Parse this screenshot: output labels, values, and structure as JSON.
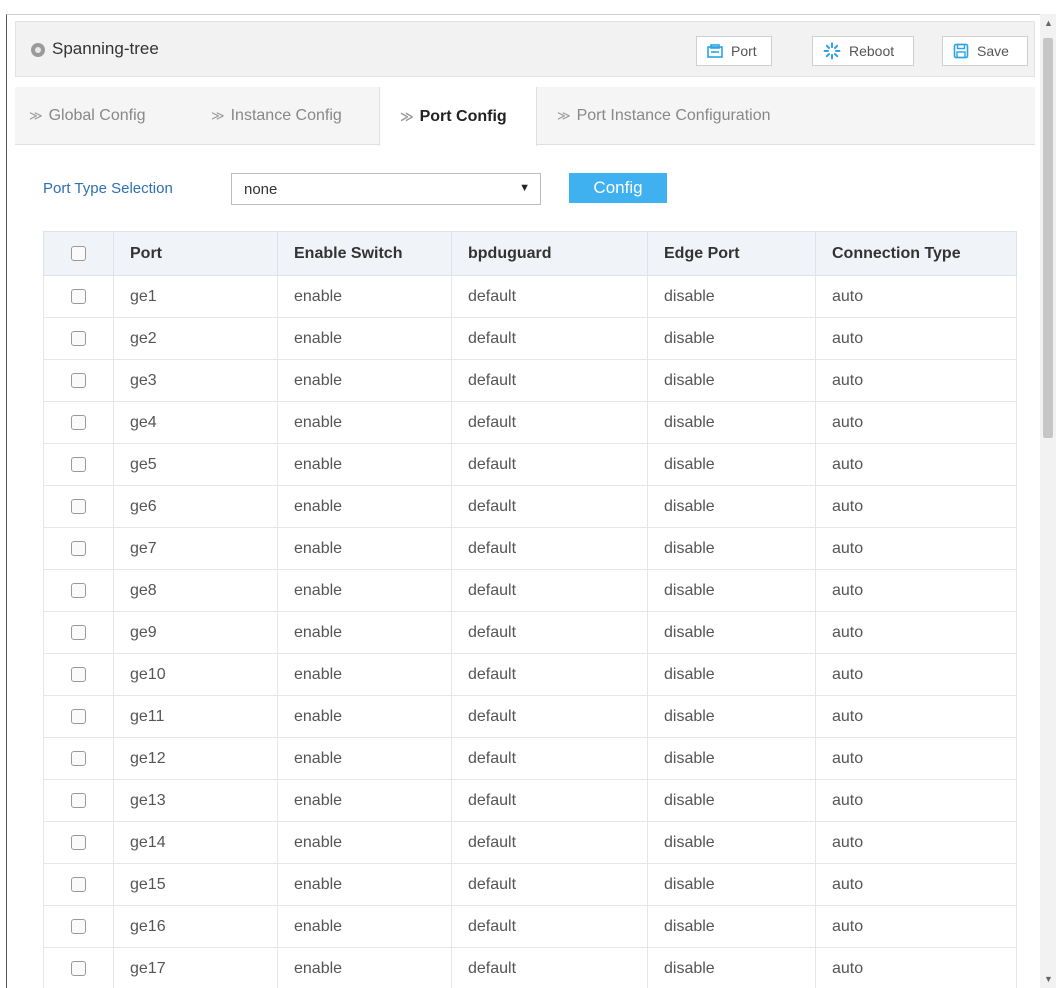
{
  "header": {
    "title": "Spanning-tree",
    "buttons": {
      "port": "Port",
      "reboot": "Reboot",
      "save": "Save"
    }
  },
  "tabs": [
    {
      "label": "Global Config",
      "active": false
    },
    {
      "label": "Instance Config",
      "active": false
    },
    {
      "label": "Port Config",
      "active": true
    },
    {
      "label": "Port Instance Configuration",
      "active": false
    }
  ],
  "filter": {
    "label": "Port Type Selection",
    "selected": "none",
    "config_label": "Config"
  },
  "table": {
    "columns": [
      "Port",
      "Enable Switch",
      "bpduguard",
      "Edge Port",
      "Connection Type"
    ],
    "rows": [
      [
        "ge1",
        "enable",
        "default",
        "disable",
        "auto"
      ],
      [
        "ge2",
        "enable",
        "default",
        "disable",
        "auto"
      ],
      [
        "ge3",
        "enable",
        "default",
        "disable",
        "auto"
      ],
      [
        "ge4",
        "enable",
        "default",
        "disable",
        "auto"
      ],
      [
        "ge5",
        "enable",
        "default",
        "disable",
        "auto"
      ],
      [
        "ge6",
        "enable",
        "default",
        "disable",
        "auto"
      ],
      [
        "ge7",
        "enable",
        "default",
        "disable",
        "auto"
      ],
      [
        "ge8",
        "enable",
        "default",
        "disable",
        "auto"
      ],
      [
        "ge9",
        "enable",
        "default",
        "disable",
        "auto"
      ],
      [
        "ge10",
        "enable",
        "default",
        "disable",
        "auto"
      ],
      [
        "ge11",
        "enable",
        "default",
        "disable",
        "auto"
      ],
      [
        "ge12",
        "enable",
        "default",
        "disable",
        "auto"
      ],
      [
        "ge13",
        "enable",
        "default",
        "disable",
        "auto"
      ],
      [
        "ge14",
        "enable",
        "default",
        "disable",
        "auto"
      ],
      [
        "ge15",
        "enable",
        "default",
        "disable",
        "auto"
      ],
      [
        "ge16",
        "enable",
        "default",
        "disable",
        "auto"
      ],
      [
        "ge17",
        "enable",
        "default",
        "disable",
        "auto"
      ]
    ]
  },
  "colors": {
    "accent": "#3fb0f0",
    "label_blue": "#2f6fb3",
    "reboot_icon": "#2aa3e6"
  }
}
